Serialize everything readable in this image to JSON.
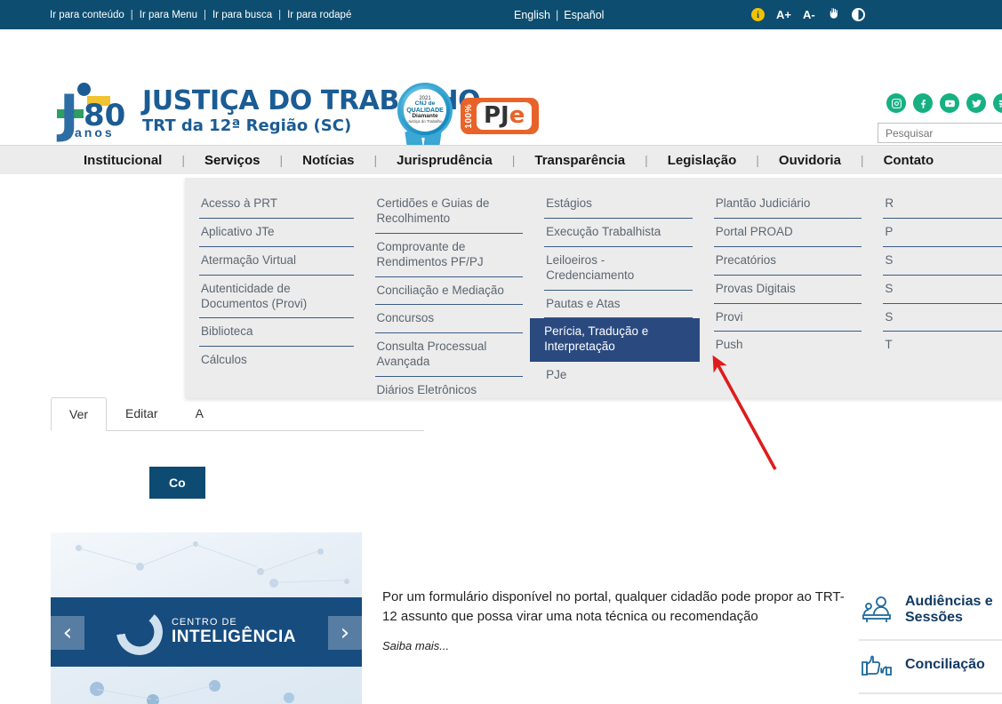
{
  "topbar": {
    "skip_links": [
      "Ir para conteúdo",
      "Ir para Menu",
      "Ir para busca",
      "Ir para rodapé"
    ],
    "separator": "|",
    "languages": [
      "English",
      "Español"
    ],
    "accessibility": {
      "info_label": "i",
      "increase_font": "A+",
      "decrease_font": "A-",
      "sign_language": "libras-hand-icon",
      "contrast": "contrast-icon"
    },
    "background_color": "#0d4d70"
  },
  "header": {
    "logo": {
      "anniversary_number": "80",
      "anniversary_word": "anos",
      "title": "JUSTIÇA DO TRABALHO",
      "subtitle": "TRT da 12ª Região (SC)",
      "color": "#1b5c94"
    },
    "badge": {
      "year": "2021",
      "line1": "CNJ de",
      "line2": "QUALIDADE",
      "level": "Diamante",
      "org": "Justiça do Trabalho"
    },
    "pje": {
      "percent": "100%",
      "name_p": "PJ",
      "name_e": "e",
      "color": "#e8632a"
    },
    "social": [
      {
        "name": "instagram-icon"
      },
      {
        "name": "facebook-icon"
      },
      {
        "name": "youtube-icon"
      },
      {
        "name": "twitter-icon"
      },
      {
        "name": "rss-icon"
      }
    ],
    "social_color": "#16b083",
    "search": {
      "placeholder": "Pesquisar",
      "value": ""
    }
  },
  "nav": {
    "items": [
      "Institucional",
      "Serviços",
      "Notícias",
      "Jurisprudência",
      "Transparência",
      "Legislação",
      "Ouvidoria",
      "Contato"
    ],
    "active": "Serviços",
    "separator": "|",
    "background_color": "#ececec"
  },
  "mega_menu": {
    "open_for": "Serviços",
    "highlight_color": "#2a4a7f",
    "columns": [
      {
        "items": [
          "Acesso à PRT",
          "Aplicativo JTe",
          "Atermação Virtual",
          "Autenticidade de Documentos (Provi)",
          "Biblioteca",
          "Cálculos"
        ]
      },
      {
        "items": [
          "Certidões e Guias de Recolhimento",
          "Comprovante de Rendimentos PF/PJ",
          "Conciliação e Mediação",
          "Concursos",
          "Consulta Processual Avançada",
          "Diários Eletrônicos"
        ]
      },
      {
        "items": [
          "Estágios",
          "Execução Trabalhista",
          "Leiloeiros - Credenciamento",
          "Pautas e Atas",
          "Perícia, Tradução e Interpretação",
          "PJe"
        ],
        "highlighted": "Perícia, Tradução e Interpretação"
      },
      {
        "items": [
          "Plantão Judiciário",
          "Portal PROAD",
          "Precatórios",
          "Provas Digitais",
          "Provi",
          "Push"
        ]
      },
      {
        "items": [
          "R",
          "P",
          "S",
          "S",
          "S",
          "T"
        ],
        "clipped": true
      }
    ]
  },
  "content": {
    "tabs": [
      {
        "label": "Ver",
        "active": true
      },
      {
        "label": "Editar",
        "active": false
      },
      {
        "label": "A",
        "active": false
      }
    ],
    "primary_button": "Co",
    "carousel": {
      "banner_line1": "CENTRO DE",
      "banner_line2": "INTELIGÊNCIA",
      "prev": "‹",
      "next": "›",
      "banner_color": "#174c7f"
    },
    "news": {
      "text": "Por um formulário disponível no portal, qualquer cidadão pode propor ao TRT-12 assunto que possa virar uma nota técnica ou recomendação",
      "more": "Saiba mais..."
    },
    "widgets": [
      {
        "label": "Audiências e Sessões",
        "icon": "audience-session-icon"
      },
      {
        "label": "Conciliação",
        "icon": "handshake-thumbs-icon"
      }
    ]
  },
  "annotation": {
    "arrow_color": "#e01b1b",
    "type": "red-arrow-pointing-to-highlighted-menu-item"
  }
}
